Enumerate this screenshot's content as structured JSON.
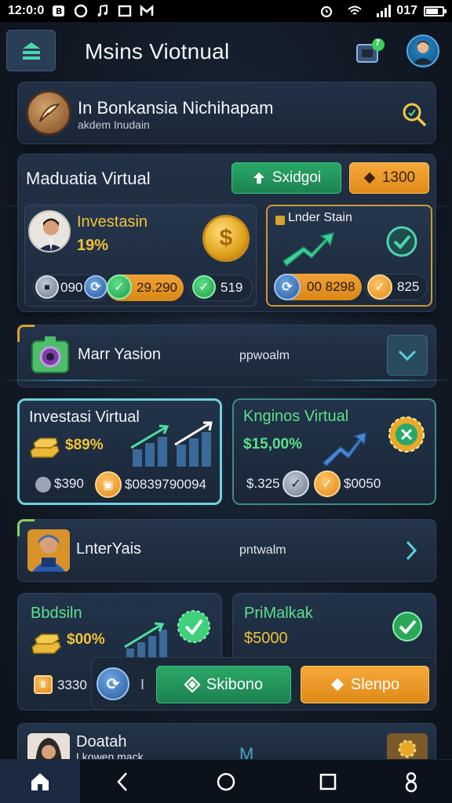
{
  "status_bar": {
    "time": "12:0:0",
    "right_text": "017"
  },
  "header": {
    "title": "Msins Viotnual",
    "notif_badge": "7"
  },
  "search_panel": {
    "title": "In Bonkansia Nichihapam",
    "subtitle": "akdem Inudain"
  },
  "overview_card": {
    "title": "Maduatia Virtual",
    "button_green": "Sxidgoi",
    "button_orange": "1300",
    "investasin": {
      "label": "Investasin",
      "value": "19%",
      "pills": [
        "090",
        "29.290",
        "519"
      ]
    },
    "lnder_stain": {
      "label": "Lnder Stain",
      "pills": [
        "00 8298",
        "825"
      ]
    }
  },
  "list_row_1": {
    "label": "Marr Yasion",
    "meta": "ppwoalm"
  },
  "invest_card_left": {
    "title": "Investasi Virtual",
    "value": "$89%",
    "foot_left": "$390",
    "foot_right": "$0839790094"
  },
  "invest_card_right": {
    "title": "Knginos Virtual",
    "value": "$15,00%",
    "foot_left": "$.325",
    "foot_right": "$0050"
  },
  "list_row_2": {
    "label": "LnterYais",
    "meta": "pntwalm"
  },
  "bottom_card_left": {
    "title": "Bbdsiln",
    "value": "$00%",
    "foot": "3330"
  },
  "bottom_card_right": {
    "title": "PriMalkak",
    "value": "$5000"
  },
  "action_bar": {
    "separator": "I",
    "green_label": "Skibono",
    "orange_label": "Slenpo"
  },
  "list_row_3": {
    "label": "Doatah",
    "meta": "Lkowen mack"
  },
  "colors": {
    "accent_green": "#2aa868",
    "accent_orange": "#f0a238",
    "accent_cyan": "#5ad0e0",
    "gold": "#e8b93a"
  }
}
